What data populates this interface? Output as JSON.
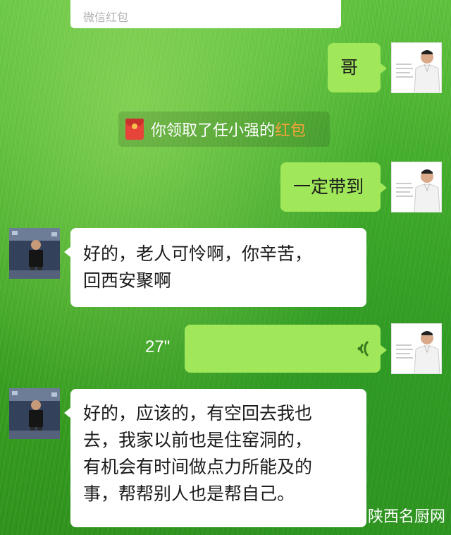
{
  "top_card": {
    "label": "微信红包"
  },
  "messages": [
    {
      "sender": "me",
      "text": "哥"
    },
    {
      "sender": "system",
      "text": "你领取了任小强的",
      "highlight": "红包"
    },
    {
      "sender": "me",
      "text": "一定带到"
    },
    {
      "sender": "them",
      "lines": [
        "好的，老人可怜啊，你辛苦，",
        "回西安聚啊"
      ]
    },
    {
      "sender": "me",
      "type": "voice",
      "duration": "27\""
    },
    {
      "sender": "them",
      "lines": [
        "好的，应该的，有空回去我也",
        "去，我家以前也是住窑洞的，",
        "有机会有时间做点力所能及的",
        "事，帮帮别人也是帮自己。"
      ]
    }
  ],
  "watermark": {
    "text": "陕西名厨网"
  },
  "colors": {
    "my_bubble": "#a0e75a",
    "their_bubble": "#ffffff",
    "highlight": "#f6a23a"
  },
  "icons": {
    "red_packet": "red-envelope-icon",
    "voice": "voice-wave-icon",
    "watermark": "wechat-logo-icon"
  }
}
